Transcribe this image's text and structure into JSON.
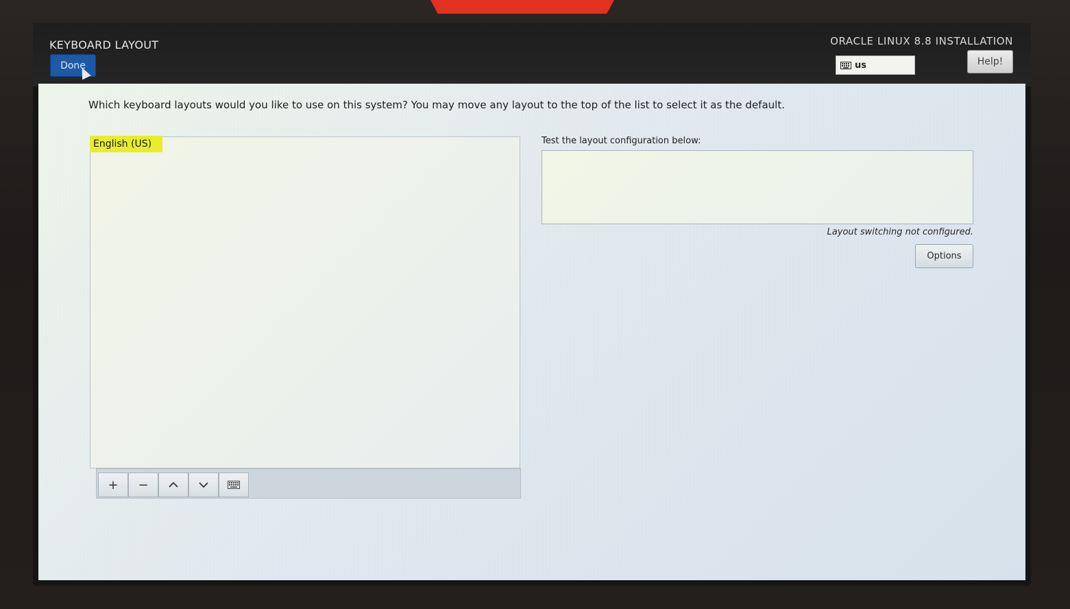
{
  "header": {
    "spoke_title": "KEYBOARD LAYOUT",
    "done_label": "Done",
    "product_title": "ORACLE LINUX 8.8 INSTALLATION",
    "keyboard_indicator": "us",
    "help_label": "Help!"
  },
  "main": {
    "instructions": "Which keyboard layouts would you like to use on this system?  You may move any layout to the top of the list to select it as the default.",
    "layouts": [
      "English (US)"
    ],
    "toolbar": {
      "add": "+",
      "remove": "−",
      "move_up": "up-chevron-icon",
      "move_down": "down-chevron-icon",
      "preview": "keyboard-icon"
    },
    "test_label": "Test the layout configuration below:",
    "test_value": "",
    "switching_note": "Layout switching not configured.",
    "options_label": "Options"
  },
  "colors": {
    "done_button": "#1c5aa8",
    "selected_row": "#e8ec2c",
    "topbar": "#1d1d1d"
  }
}
